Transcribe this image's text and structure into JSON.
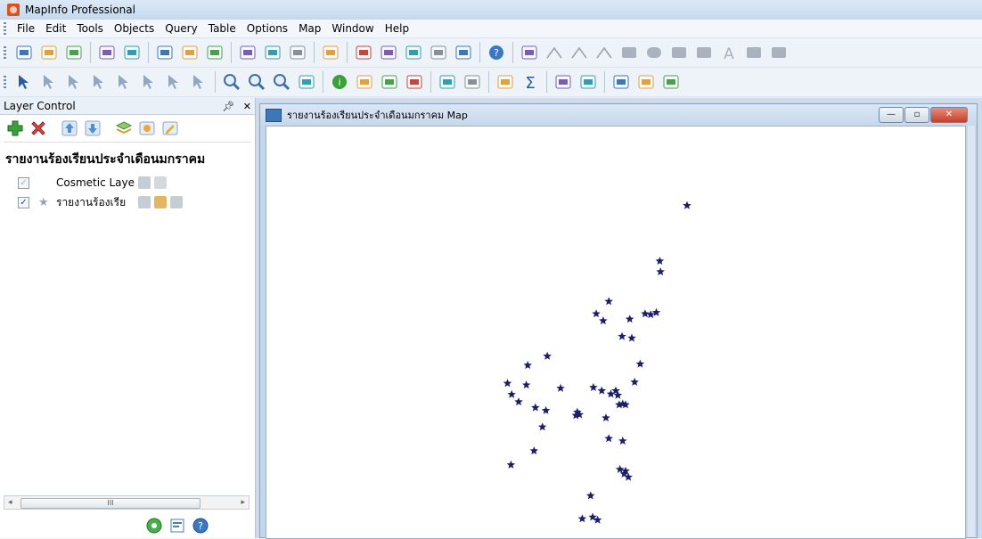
{
  "window": {
    "title": "MapInfo Professional"
  },
  "menu": [
    "File",
    "Edit",
    "Tools",
    "Objects",
    "Query",
    "Table",
    "Options",
    "Map",
    "Window",
    "Help"
  ],
  "toolbar1": [
    "new-icon",
    "open-icon",
    "open-workspace-icon",
    "|",
    "save-icon",
    "save-copy-icon",
    "|",
    "open-folder-icon",
    "print-preview-icon",
    "print-icon",
    "|",
    "cut-icon",
    "copy-icon",
    "paste-icon",
    "|",
    "undo-icon",
    "|",
    "browser-icon",
    "map-window-icon",
    "graph-icon",
    "layout-icon",
    "redistrict-icon",
    "|",
    "help-icon",
    "|",
    "symbol-icon",
    "line-icon",
    "polyline-icon",
    "arc-icon",
    "polygon-icon",
    "ellipse-icon",
    "rectangle-icon",
    "rounded-rect-icon",
    "text-icon",
    "frame-icon",
    "reshape-icon"
  ],
  "toolbar2": [
    "select-icon",
    "marquee-select-icon",
    "radius-select-icon",
    "polygon-select-icon",
    "boundary-select-icon",
    "invert-select-icon",
    "graph-select-icon",
    "unselect-icon",
    "|",
    "zoom-in-icon",
    "zoom-out-icon",
    "change-view-icon",
    "grabber-icon",
    "|",
    "info-icon",
    "label-icon",
    "drag-map-icon",
    "layer-control-icon",
    "|",
    "legend-icon",
    "ruler-icon",
    "|",
    "statistics-icon",
    "sum-icon",
    "|",
    "hotlink-icon",
    "clip-region-icon",
    "|",
    "set-target-icon",
    "split-icon",
    "scale-bar-icon"
  ],
  "layer_control": {
    "title": "Layer Control",
    "controls": "X",
    "pin": "†",
    "group_label": "รายงานร้องเรียนประจำเดือนมกราคม",
    "layers": [
      {
        "name": "Cosmetic Laye",
        "checked": true,
        "dim": true,
        "icon": ""
      },
      {
        "name": "รายงานร้องเรีย",
        "checked": true,
        "dim": false,
        "icon": "star-icon"
      }
    ],
    "scroll_label": "III"
  },
  "map_window": {
    "title": "รายงานร้องเรียนประจำเดือนมกราคม Map",
    "buttons": {
      "minimize": "—",
      "restore": "▫",
      "close": "✕"
    },
    "star_color": "#1b1f6b",
    "points": [
      [
        0.602,
        0.192
      ],
      [
        0.563,
        0.327
      ],
      [
        0.564,
        0.353
      ],
      [
        0.49,
        0.425
      ],
      [
        0.472,
        0.455
      ],
      [
        0.482,
        0.472
      ],
      [
        0.542,
        0.455
      ],
      [
        0.55,
        0.457
      ],
      [
        0.558,
        0.452
      ],
      [
        0.52,
        0.468
      ],
      [
        0.509,
        0.51
      ],
      [
        0.523,
        0.514
      ],
      [
        0.402,
        0.558
      ],
      [
        0.374,
        0.58
      ],
      [
        0.372,
        0.628
      ],
      [
        0.345,
        0.624
      ],
      [
        0.421,
        0.636
      ],
      [
        0.468,
        0.634
      ],
      [
        0.351,
        0.651
      ],
      [
        0.361,
        0.669
      ],
      [
        0.4,
        0.69
      ],
      [
        0.505,
        0.676
      ],
      [
        0.51,
        0.674
      ],
      [
        0.514,
        0.676
      ],
      [
        0.527,
        0.621
      ],
      [
        0.535,
        0.577
      ],
      [
        0.48,
        0.642
      ],
      [
        0.385,
        0.683
      ],
      [
        0.445,
        0.694
      ],
      [
        0.443,
        0.702
      ],
      [
        0.448,
        0.7
      ],
      [
        0.486,
        0.708
      ],
      [
        0.493,
        0.65
      ],
      [
        0.5,
        0.642
      ],
      [
        0.503,
        0.653
      ],
      [
        0.395,
        0.73
      ],
      [
        0.51,
        0.764
      ],
      [
        0.49,
        0.758
      ],
      [
        0.35,
        0.822
      ],
      [
        0.383,
        0.788
      ],
      [
        0.512,
        0.844
      ],
      [
        0.518,
        0.852
      ],
      [
        0.514,
        0.837
      ],
      [
        0.506,
        0.833
      ],
      [
        0.464,
        0.897
      ],
      [
        0.452,
        0.953
      ],
      [
        0.467,
        0.949
      ],
      [
        0.474,
        0.956
      ]
    ]
  },
  "colors": {
    "accent": "#3d77b6",
    "titlebar": "#c4d8ef"
  }
}
